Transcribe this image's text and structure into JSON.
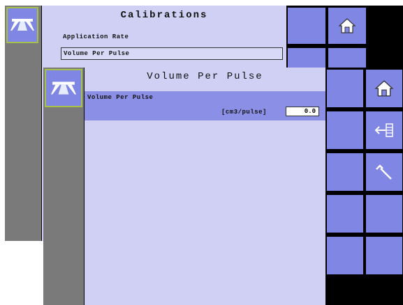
{
  "back_screen": {
    "title": "Calibrations",
    "items": [
      {
        "label": "Application Rate"
      },
      {
        "label": "Volume Per Pulse"
      }
    ]
  },
  "front_screen": {
    "title": "Volume Per Pulse",
    "field_label": "Volume Per Pulse",
    "unit": "[cm3/pulse]",
    "value": "0.0"
  },
  "icons": {
    "logo": "spray-boom-icon",
    "home": "home-icon",
    "back": "back-arrow-icon",
    "tools": "wrench-icon"
  },
  "colors": {
    "content_bg": "#cfd0f4",
    "button_bg": "#7f86e3",
    "selected_row": "#8c8fe6",
    "sidebar": "#7a7a7a",
    "logo_border": "#a6c24a"
  }
}
